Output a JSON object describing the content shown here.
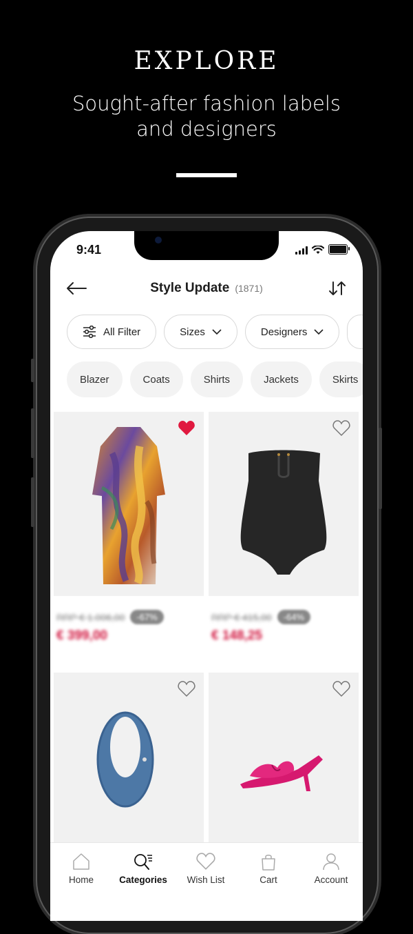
{
  "hero": {
    "title": "EXPLORE",
    "subtitle_line1": "Sought-after fashion labels",
    "subtitle_line2": "and designers"
  },
  "status_bar": {
    "time": "9:41"
  },
  "nav": {
    "title": "Style Update",
    "count": "(1871)"
  },
  "filters": {
    "all_filter": "All Filter",
    "sizes": "Sizes",
    "designers": "Designers"
  },
  "categories": [
    "Blazer",
    "Coats",
    "Shirts",
    "Jackets",
    "Skirts"
  ],
  "products": [
    {
      "name": "printed kaftan dress",
      "rrp": "RRP € 1.006,00",
      "discount": "-67%",
      "price": "€ 399,00",
      "wishlisted": true
    },
    {
      "name": "black strapless swimsuit",
      "rrp": "RRP € 415,00",
      "discount": "-64%",
      "price": "€ 148,25",
      "wishlisted": false
    },
    {
      "name": "denim oval bag",
      "wishlisted": false
    },
    {
      "name": "pink bow sandal",
      "wishlisted": false
    }
  ],
  "tabs": [
    {
      "label": "Home",
      "icon": "home-icon"
    },
    {
      "label": "Categories",
      "icon": "categories-icon",
      "active": true
    },
    {
      "label": "Wish List",
      "icon": "heart-icon"
    },
    {
      "label": "Cart",
      "icon": "bag-icon"
    },
    {
      "label": "Account",
      "icon": "person-icon"
    }
  ],
  "colors": {
    "accent_red": "#d0103a",
    "wish_red": "#e0193f"
  }
}
